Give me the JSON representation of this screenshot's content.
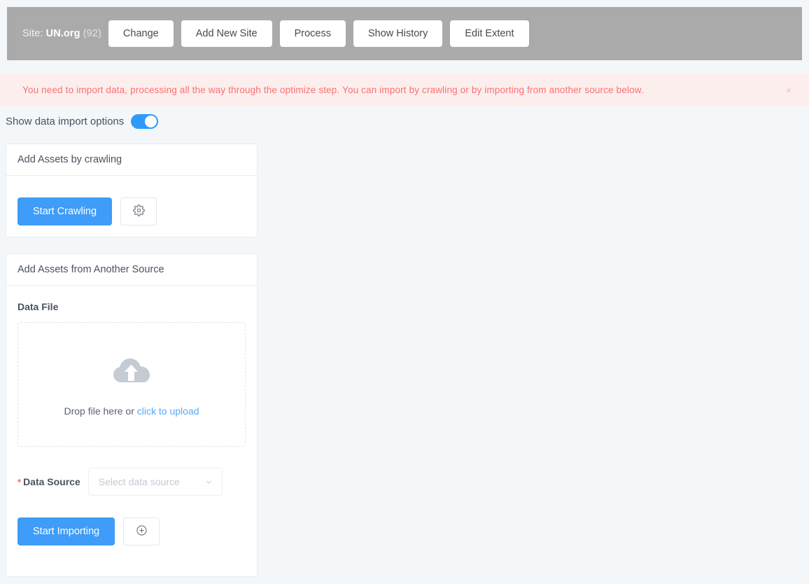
{
  "topbar": {
    "site_prefix": "Site: ",
    "site_name": "UN.org",
    "site_count": " (92)",
    "buttons": [
      {
        "label": "Change",
        "name": "change-site-button"
      },
      {
        "label": "Add New Site",
        "name": "add-new-site-button"
      },
      {
        "label": "Process",
        "name": "process-button"
      },
      {
        "label": "Show History",
        "name": "show-history-button"
      },
      {
        "label": "Edit Extent",
        "name": "edit-extent-button"
      }
    ]
  },
  "alert": {
    "message": "You need to import data, processing all the way through the optimize step. You can import by crawling or by importing from another source below.",
    "close_label": "×",
    "background_color": "#fdeeee",
    "text_color": "#f87171"
  },
  "import_options_toggle": {
    "label": "Show data import options",
    "state": "on",
    "accent_color": "#2e9bfa"
  },
  "crawl_card": {
    "title": "Add Assets by crawling",
    "start_button_label": "Start Crawling",
    "settings_icon": "gear-icon"
  },
  "source_card": {
    "title": "Add Assets from Another Source",
    "data_file_label": "Data File",
    "dropzone": {
      "icon": "cloud-upload-icon",
      "text_prefix": "Drop file here or ",
      "link_text": "click to upload"
    },
    "data_source": {
      "required_marker": "*",
      "label": "Data Source",
      "placeholder": "Select data source",
      "chevron_icon": "chevron-down-icon"
    },
    "start_button_label": "Start Importing",
    "add_icon": "plus-circle-icon"
  },
  "theme": {
    "page_background": "#f3f7fa",
    "primary_button": "#3f9cf8",
    "topbar_background": "#aaaaaa",
    "link_color": "#56a9f8"
  }
}
